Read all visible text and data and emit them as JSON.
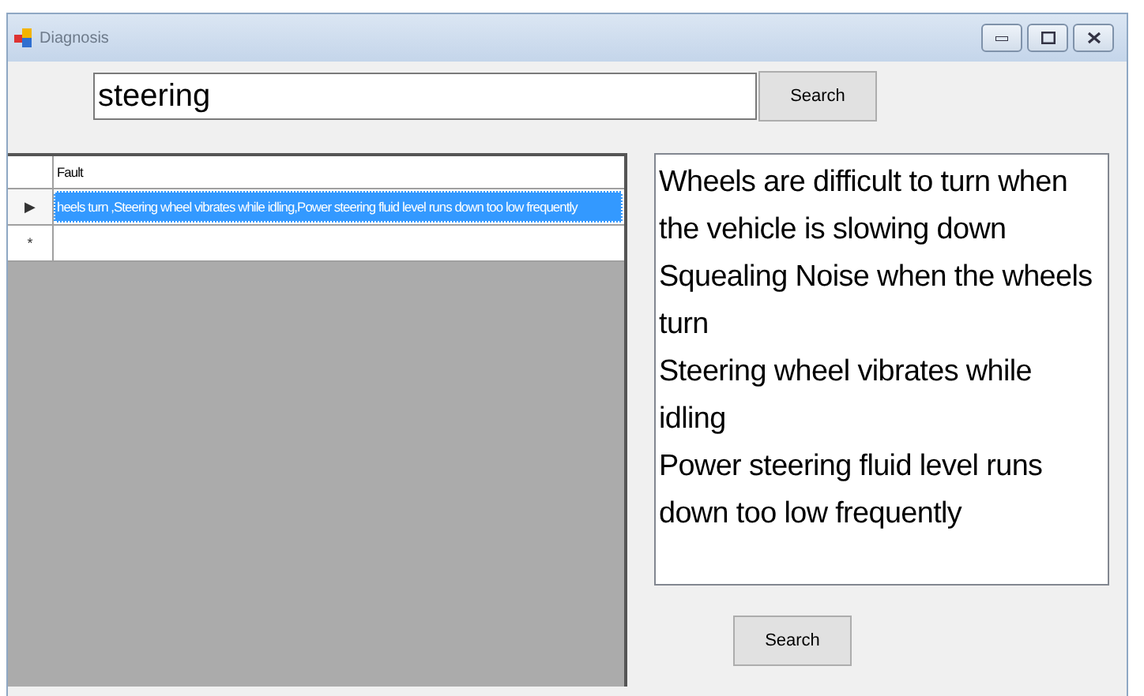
{
  "window": {
    "title": "Diagnosis"
  },
  "search": {
    "value": "steering",
    "button": "Search"
  },
  "grid": {
    "columns": [
      "Fault"
    ],
    "rows": [
      {
        "header": "▶",
        "cells": [
          "heels turn ,Steering wheel vibrates while idling,Power steering fluid level runs down too low frequently"
        ],
        "selected": true
      },
      {
        "header": "*",
        "cells": [
          ""
        ],
        "selected": false
      }
    ]
  },
  "results": {
    "lines": [
      "Wheels are difficult to turn when the vehicle is slowing down",
      "Squealing Noise when the wheels turn",
      "Steering wheel vibrates while idling",
      "Power steering fluid level runs down too low frequently"
    ]
  },
  "bottom_button": "Search"
}
